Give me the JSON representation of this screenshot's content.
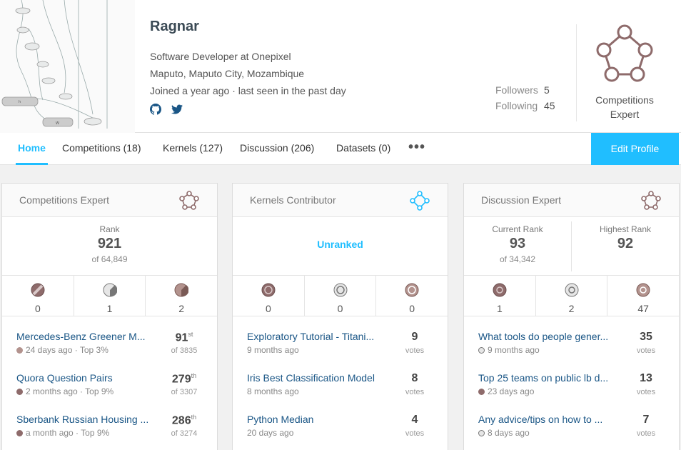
{
  "profile": {
    "name": "Ragnar",
    "occupation": "Software Developer at Onepixel",
    "location": "Maputo, Maputo City, Mozambique",
    "joined": "Joined a year ago · last seen in the past day",
    "followers_label": "Followers",
    "followers": "5",
    "following_label": "Following",
    "following": "45",
    "tier_label": "Competitions Expert",
    "social_icons": [
      "github-icon",
      "twitter-icon"
    ]
  },
  "tabs": [
    "Home",
    "Competitions (18)",
    "Kernels (127)",
    "Discussion (206)",
    "Datasets (0)"
  ],
  "edit_label": "Edit Profile",
  "colors": {
    "accent": "#20beff",
    "link": "#1a5686",
    "tier": "#8e6b6b"
  },
  "cards": [
    {
      "title": "Competitions Expert",
      "rank_label": "Rank",
      "rank": "921",
      "rank_of": "of 64,849",
      "medals": [
        "0",
        "1",
        "2"
      ],
      "items": [
        {
          "title": "Mercedes-Benz Greener M...",
          "sub": "24 days ago · Top 3%",
          "val": "91",
          "sup": "st",
          "unit": "of 3835"
        },
        {
          "title": "Quora Question Pairs",
          "sub": "2 months ago · Top 9%",
          "val": "279",
          "sup": "th",
          "unit": "of 3307"
        },
        {
          "title": "Sberbank Russian Housing ...",
          "sub": "a month ago · Top 9%",
          "val": "286",
          "sup": "th",
          "unit": "of 3274"
        }
      ]
    },
    {
      "title": "Kernels Contributor",
      "unranked": "Unranked",
      "medals": [
        "0",
        "0",
        "0"
      ],
      "items": [
        {
          "title": "Exploratory Tutorial - Titani...",
          "sub": "9 months ago",
          "val": "9",
          "unit": "votes"
        },
        {
          "title": "Iris Best Classification Model",
          "sub": "8 months ago",
          "val": "8",
          "unit": "votes"
        },
        {
          "title": "Python Median",
          "sub": "20 days ago",
          "val": "4",
          "unit": "votes"
        }
      ]
    },
    {
      "title": "Discussion Expert",
      "current_label": "Current Rank",
      "current": "93",
      "current_of": "of 34,342",
      "highest_label": "Highest Rank",
      "highest": "92",
      "medals": [
        "1",
        "2",
        "47"
      ],
      "items": [
        {
          "title": "What tools do people gener...",
          "sub": "9 months ago",
          "val": "35",
          "unit": "votes"
        },
        {
          "title": "Top 25 teams on public lb d...",
          "sub": "23 days ago",
          "val": "13",
          "unit": "votes"
        },
        {
          "title": "Any advice/tips on how to ...",
          "sub": "8 days ago",
          "val": "7",
          "unit": "votes"
        }
      ]
    }
  ]
}
